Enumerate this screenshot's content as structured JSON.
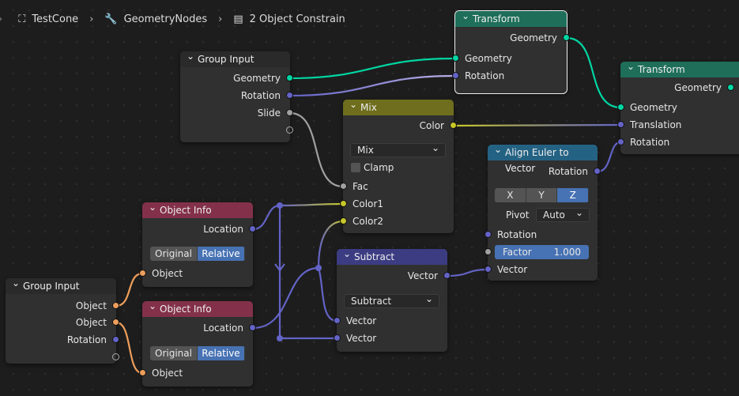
{
  "breadcrumb": {
    "object": "TestCone",
    "modifier": "GeometryNodes",
    "nodegroup": "2 Object Constrain",
    "icons": [
      "object-icon",
      "wrench-icon",
      "node-tree-icon"
    ]
  },
  "colors": {
    "geometry": "#00d6a3",
    "vector": "#6363c7",
    "float": "#a1a1a1",
    "color": "#c7c729",
    "object": "#ed9e5c",
    "selected": "#4772b3"
  },
  "nodes": {
    "group_input_1": {
      "title": "Group Input",
      "outputs": [
        "Geometry",
        "Rotation",
        "Slide"
      ]
    },
    "transform_1": {
      "title": "Transform",
      "output": "Geometry",
      "inputs": [
        "Geometry",
        "Rotation"
      ]
    },
    "transform_2": {
      "title": "Transform",
      "output": "Geometry",
      "inputs": [
        "Geometry",
        "Translation",
        "Rotation"
      ]
    },
    "mix": {
      "title": "Mix",
      "output": "Color",
      "blend_mode": "Mix",
      "clamp_label": "Clamp",
      "clamp": false,
      "inputs": [
        "Fac",
        "Color1",
        "Color2"
      ]
    },
    "align_euler": {
      "title": "Align Euler to Vector",
      "output": "Rotation",
      "axes": [
        "X",
        "Y",
        "Z"
      ],
      "axis_selected": "Z",
      "pivot_label": "Pivot",
      "pivot": "Auto",
      "inputs": [
        "Rotation",
        "Vector"
      ],
      "factor_label": "Factor",
      "factor": "1.000"
    },
    "object_info_1": {
      "title": "Object Info",
      "output": "Location",
      "modes": [
        "Original",
        "Relative"
      ],
      "mode_selected": "Relative",
      "input": "Object"
    },
    "object_info_2": {
      "title": "Object Info",
      "output": "Location",
      "modes": [
        "Original",
        "Relative"
      ],
      "mode_selected": "Relative",
      "input": "Object"
    },
    "subtract": {
      "title": "Subtract",
      "output": "Vector",
      "operation": "Subtract",
      "inputs": [
        "Vector",
        "Vector"
      ]
    },
    "group_input_2": {
      "title": "Group Input",
      "outputs": [
        "Object",
        "Object",
        "Rotation"
      ]
    }
  }
}
